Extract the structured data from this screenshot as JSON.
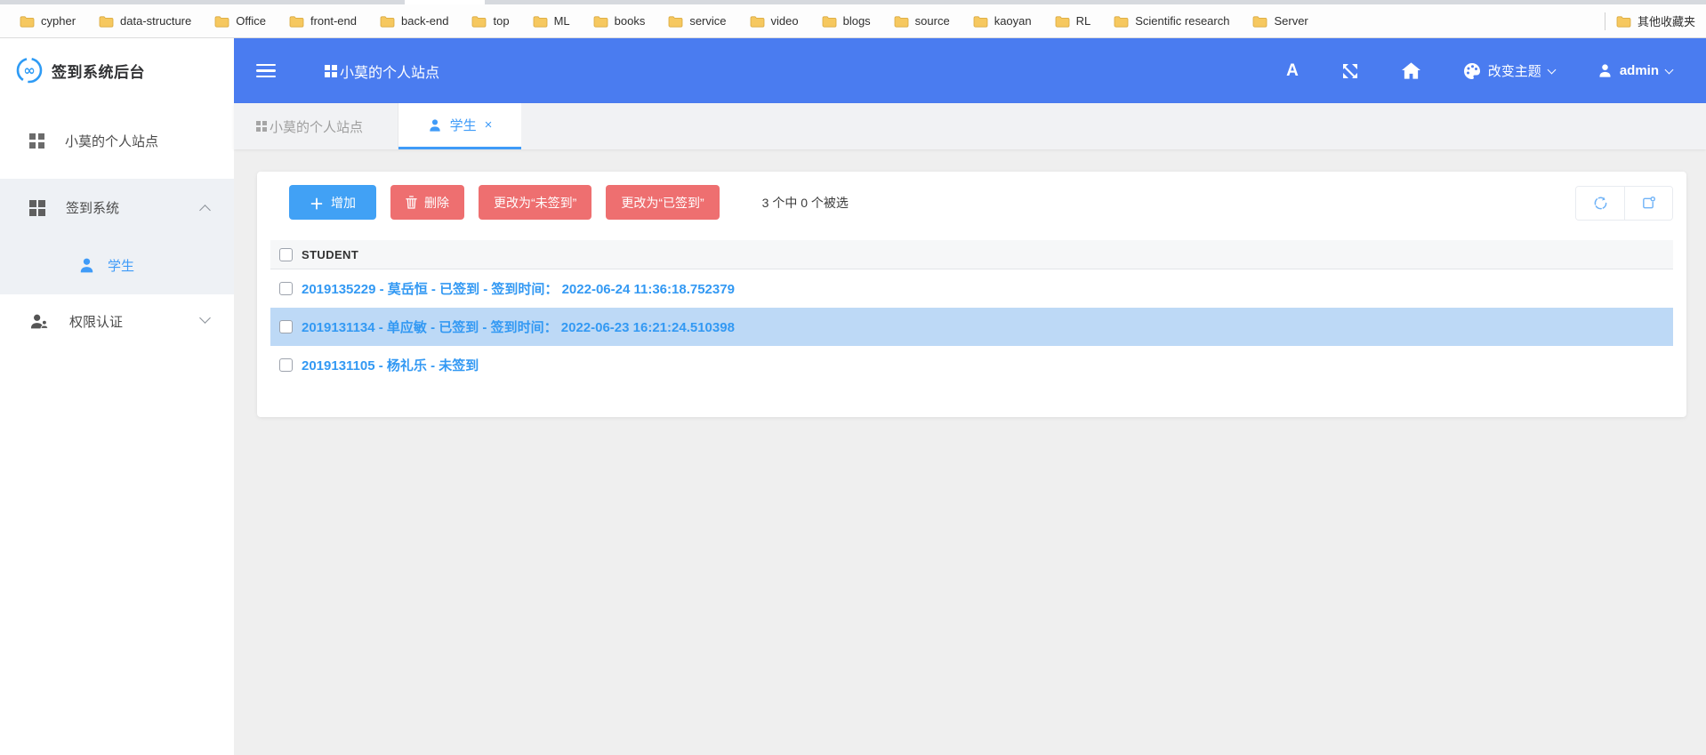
{
  "bookmarks_bar": {
    "items": [
      "cypher",
      "data-structure",
      "Office",
      "front-end",
      "back-end",
      "top",
      "ML",
      "books",
      "service",
      "video",
      "blogs",
      "source",
      "kaoyan",
      "RL",
      "Scientific research",
      "Server"
    ],
    "other_label": "其他收藏夹"
  },
  "sidebar": {
    "logo_text": "签到系统后台",
    "item_site": "小莫的个人站点",
    "item_checkin": "签到系统",
    "item_student": "学生",
    "item_auth": "权限认证"
  },
  "header": {
    "title": "小莫的个人站点",
    "lang_icon": "A",
    "theme_label": "改变主题",
    "user_label": "admin"
  },
  "tabs": {
    "tab_site": "小莫的个人站点",
    "tab_student": "学生",
    "close_glyph": "×"
  },
  "toolbar": {
    "add_icon": "＋",
    "add_label": "增加",
    "delete_label": "删除",
    "mark_unchecked_label": "更改为“未签到”",
    "mark_checked_label": "更改为“已签到”",
    "selection_status": "3 个中 0 个被选"
  },
  "table": {
    "column_header": "STUDENT",
    "rows": [
      {
        "text": "2019135229 - 莫岳恒 - 已签到 - 签到时间： 2022-06-24 11:36:18.752379"
      },
      {
        "text": "2019131134 - 单应敏 - 已签到 - 签到时间： 2022-06-23 16:21:24.510398"
      },
      {
        "text": "2019131105 - 杨礼乐 - 未签到"
      }
    ]
  },
  "colors": {
    "header_blue": "#4a7cf0",
    "accent_blue": "#3f9bf8",
    "link_blue": "#3399f3",
    "add_button_blue": "#41a1f5",
    "danger_red": "#ee6f70",
    "row_highlight": "#bdd9f6",
    "sidebar_group_bg": "#eef1f5",
    "content_bg": "#efefef",
    "folder_yellow": "#f6c85f"
  }
}
